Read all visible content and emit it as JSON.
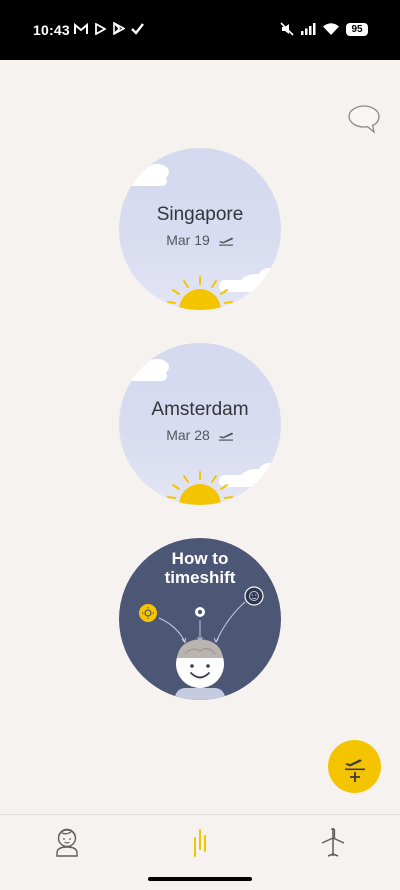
{
  "status_bar": {
    "time": "10:43",
    "battery": "95",
    "left_icons": [
      "gmail-icon",
      "play-icon",
      "play-store-icon",
      "check-icon"
    ],
    "right_icons": [
      "mute-icon",
      "signal-icon",
      "wifi-icon"
    ]
  },
  "trips": [
    {
      "city": "Singapore",
      "date": "Mar 19",
      "icon": "plane-departure-icon"
    },
    {
      "city": "Amsterdam",
      "date": "Mar 28",
      "icon": "plane-departure-icon"
    }
  ],
  "how_to": {
    "title": "How to timeshift"
  },
  "nav": {
    "items": [
      {
        "name": "profile",
        "icon": "profile-face-icon"
      },
      {
        "name": "timeline",
        "icon": "timeline-icon",
        "active": true
      },
      {
        "name": "trips",
        "icon": "plane-icon"
      }
    ]
  },
  "colors": {
    "background": "#f5f2ef",
    "accent": "#f5c400",
    "sky": "#d4d9ef",
    "night": "#4c5675"
  }
}
